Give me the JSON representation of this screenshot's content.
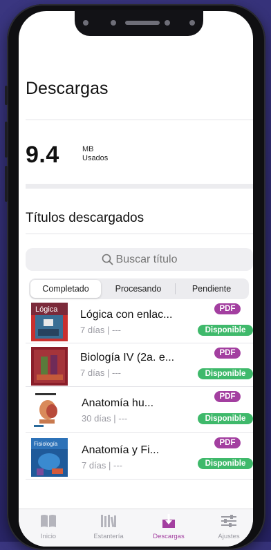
{
  "page": {
    "title": "Descargas",
    "storage": {
      "value": "9.4",
      "unit": "MB",
      "label": "Usados"
    },
    "section_title": "Títulos descargados",
    "search": {
      "placeholder": "Buscar título"
    },
    "segments": [
      {
        "label": "Completado",
        "active": true
      },
      {
        "label": "Procesando",
        "active": false
      },
      {
        "label": "Pendiente",
        "active": false
      }
    ]
  },
  "downloads": [
    {
      "title": "Lógica con enlac...",
      "meta": "7 días | ---",
      "format": "PDF",
      "status": "Disponible"
    },
    {
      "title": "Biología IV (2a. e...",
      "meta": "7 días | ---",
      "format": "PDF",
      "status": "Disponible"
    },
    {
      "title": "Anatomía hu...",
      "meta": "30 días | ---",
      "format": "PDF",
      "status": "Disponible"
    },
    {
      "title": "Anatomía y Fi...",
      "meta": "7 días | ---",
      "format": "PDF",
      "status": "Disponible"
    }
  ],
  "tabbar": [
    {
      "label": "Inicio",
      "icon": "book-open-icon",
      "active": false
    },
    {
      "label": "Estantería",
      "icon": "bookshelf-icon",
      "active": false
    },
    {
      "label": "Descargas",
      "icon": "download-icon",
      "active": true
    },
    {
      "label": "Ajustes",
      "icon": "sliders-icon",
      "active": false
    }
  ],
  "colors": {
    "accent": "#a33fa0",
    "available": "#3fb96b",
    "background": "#2f2b6e"
  }
}
